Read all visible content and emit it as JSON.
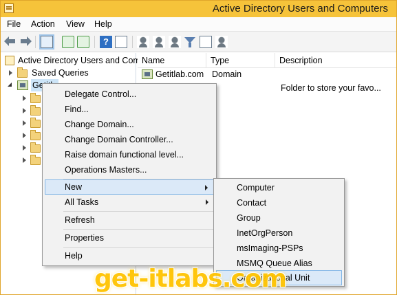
{
  "window": {
    "title": "Active Directory Users and Computers",
    "accent_color": "#f6c33a"
  },
  "menubar": {
    "items": [
      "File",
      "Action",
      "View",
      "Help"
    ]
  },
  "toolbar": {
    "icons": [
      "back-arrow-icon",
      "forward-arrow-icon",
      "console-tree-icon",
      "refresh-icon",
      "export-list-icon",
      "help-icon",
      "show-pane-icon",
      "user-icon",
      "users-group-icon",
      "group-icon",
      "filter-icon",
      "find-icon",
      "add-to-group-icon"
    ]
  },
  "tree": {
    "root_label": "Active Directory Users and Com",
    "saved_queries_label": "Saved Queries",
    "domain_label": "Getitlab.com",
    "domain_visible": "Getitla"
  },
  "list": {
    "columns": [
      "Name",
      "Type",
      "Description"
    ],
    "rows": [
      {
        "name": "Getitlab.com",
        "type": "Domain",
        "description": ""
      },
      {
        "name": "",
        "type": "",
        "description": "Folder to store your favo..."
      }
    ]
  },
  "context_menu": {
    "items": [
      "Delegate Control...",
      "Find...",
      "Change Domain...",
      "Change Domain Controller...",
      "Raise domain functional level...",
      "Operations Masters...",
      "New",
      "All Tasks",
      "Refresh",
      "Properties",
      "Help"
    ],
    "highlighted": "New"
  },
  "submenu": {
    "items": [
      "Computer",
      "Contact",
      "Group",
      "InetOrgPerson",
      "msImaging-PSPs",
      "MSMQ Queue Alias",
      "Organizational Unit"
    ],
    "highlighted": "Organizational Unit"
  },
  "watermark": "get-itlabs.com"
}
